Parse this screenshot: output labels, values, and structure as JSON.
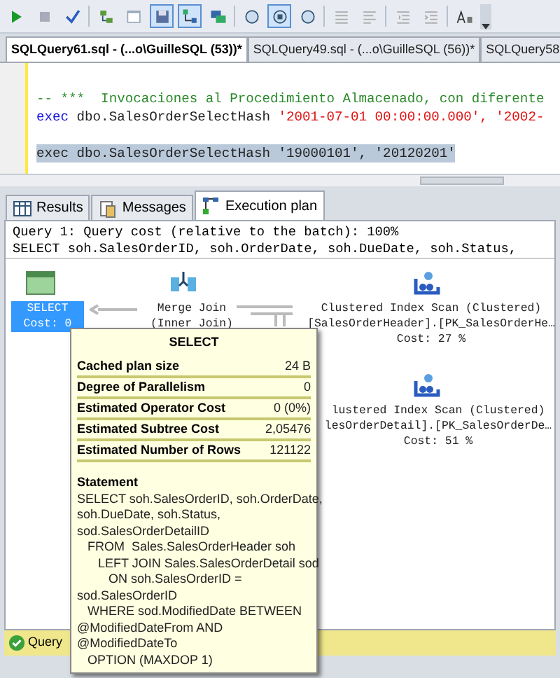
{
  "toolbar": [
    {
      "pressed": false
    },
    {
      "pressed": false
    },
    {
      "pressed": false
    },
    {
      "pressed": false
    },
    {
      "pressed": false
    },
    {
      "pressed": true
    },
    {
      "pressed": true
    },
    {
      "pressed": false
    },
    {
      "pressed": false
    },
    {
      "pressed": true
    },
    {
      "pressed": false
    },
    {
      "pressed": false
    },
    {
      "pressed": false
    },
    {
      "pressed": false
    },
    {
      "pressed": false
    },
    {
      "pressed": false
    }
  ],
  "document_tabs": [
    {
      "label": "SQLQuery61.sql - (...o\\GuilleSQL (53))*",
      "selected": true
    },
    {
      "label": "SQLQuery49.sql - (...o\\GuilleSQL (56))*",
      "selected": false
    },
    {
      "label": "SQLQuery58",
      "selected": false
    }
  ],
  "editor": {
    "lines": [
      {
        "kind": "blank"
      },
      {
        "kind": "code",
        "selected": false,
        "segments": [
          {
            "kind": "comment",
            "text": "-- ***  Invocaciones al Procedimiento Almacenado, con diferente"
          }
        ]
      },
      {
        "kind": "code",
        "selected": false,
        "segments": [
          {
            "kind": "keyword",
            "text": "exec"
          },
          {
            "kind": "plain",
            "text": " dbo.SalesOrderSelectHash "
          },
          {
            "kind": "string",
            "text": "'2001-07-01 00:00:00.000', '2002-"
          }
        ]
      },
      {
        "kind": "blank"
      },
      {
        "kind": "code",
        "selected": true,
        "segments": [
          {
            "kind": "plain",
            "text": "exec dbo.SalesOrderSelectHash '19000101', '20120201'"
          }
        ]
      }
    ]
  },
  "result_tabs": [
    {
      "label": "Results",
      "kind": "grid",
      "selected": false
    },
    {
      "label": "Messages",
      "kind": "messages",
      "selected": false
    },
    {
      "label": "Execution plan",
      "kind": "plan",
      "selected": true
    }
  ],
  "plan": {
    "header": [
      "Query 1: Query cost (relative to the batch): 100%",
      "SELECT soh.SalesOrderID, soh.OrderDate, soh.DueDate, soh.Status,"
    ],
    "nodes": [
      {
        "kind": "select",
        "selected": true,
        "lines": [
          "SELECT",
          "Cost: 0"
        ]
      },
      {
        "kind": "merge",
        "selected": false,
        "lines": [
          "Merge Join",
          "(Inner Join)"
        ]
      },
      {
        "kind": "scan",
        "selected": false,
        "lines": [
          "Clustered Index Scan (Clustered)",
          "[SalesOrderHeader].[PK_SalesOrderHe…",
          "Cost: 27 %"
        ]
      },
      {
        "kind": "scan",
        "selected": false,
        "lines": [
          "lustered Index Scan (Clustered)",
          "lesOrderDetail].[PK_SalesOrderDe…",
          "Cost: 51 %"
        ]
      }
    ]
  },
  "tooltip": {
    "title": "SELECT",
    "properties": [
      {
        "name": "Cached plan size",
        "value": "24 B"
      },
      {
        "name": "Degree of Parallelism",
        "value": "0"
      },
      {
        "name": "Estimated Operator Cost",
        "value": "0 (0%)"
      },
      {
        "name": "Estimated Subtree Cost",
        "value": "2,05476"
      },
      {
        "name": "Estimated Number of Rows",
        "value": "121122"
      }
    ],
    "statement_title": "Statement",
    "statement_lines": [
      "SELECT soh.SalesOrderID, soh.OrderDate,",
      "soh.DueDate, soh.Status,",
      "sod.SalesOrderDetailID",
      "   FROM  Sales.SalesOrderHeader soh",
      "      LEFT JOIN Sales.SalesOrderDetail sod",
      "         ON soh.SalesOrderID =",
      "sod.SalesOrderID",
      "   WHERE sod.ModifiedDate BETWEEN",
      "@ModifiedDateFrom AND",
      "@ModifiedDateTo",
      "   OPTION (MAXDOP 1)"
    ]
  },
  "status_bar": {
    "text": "Query"
  }
}
